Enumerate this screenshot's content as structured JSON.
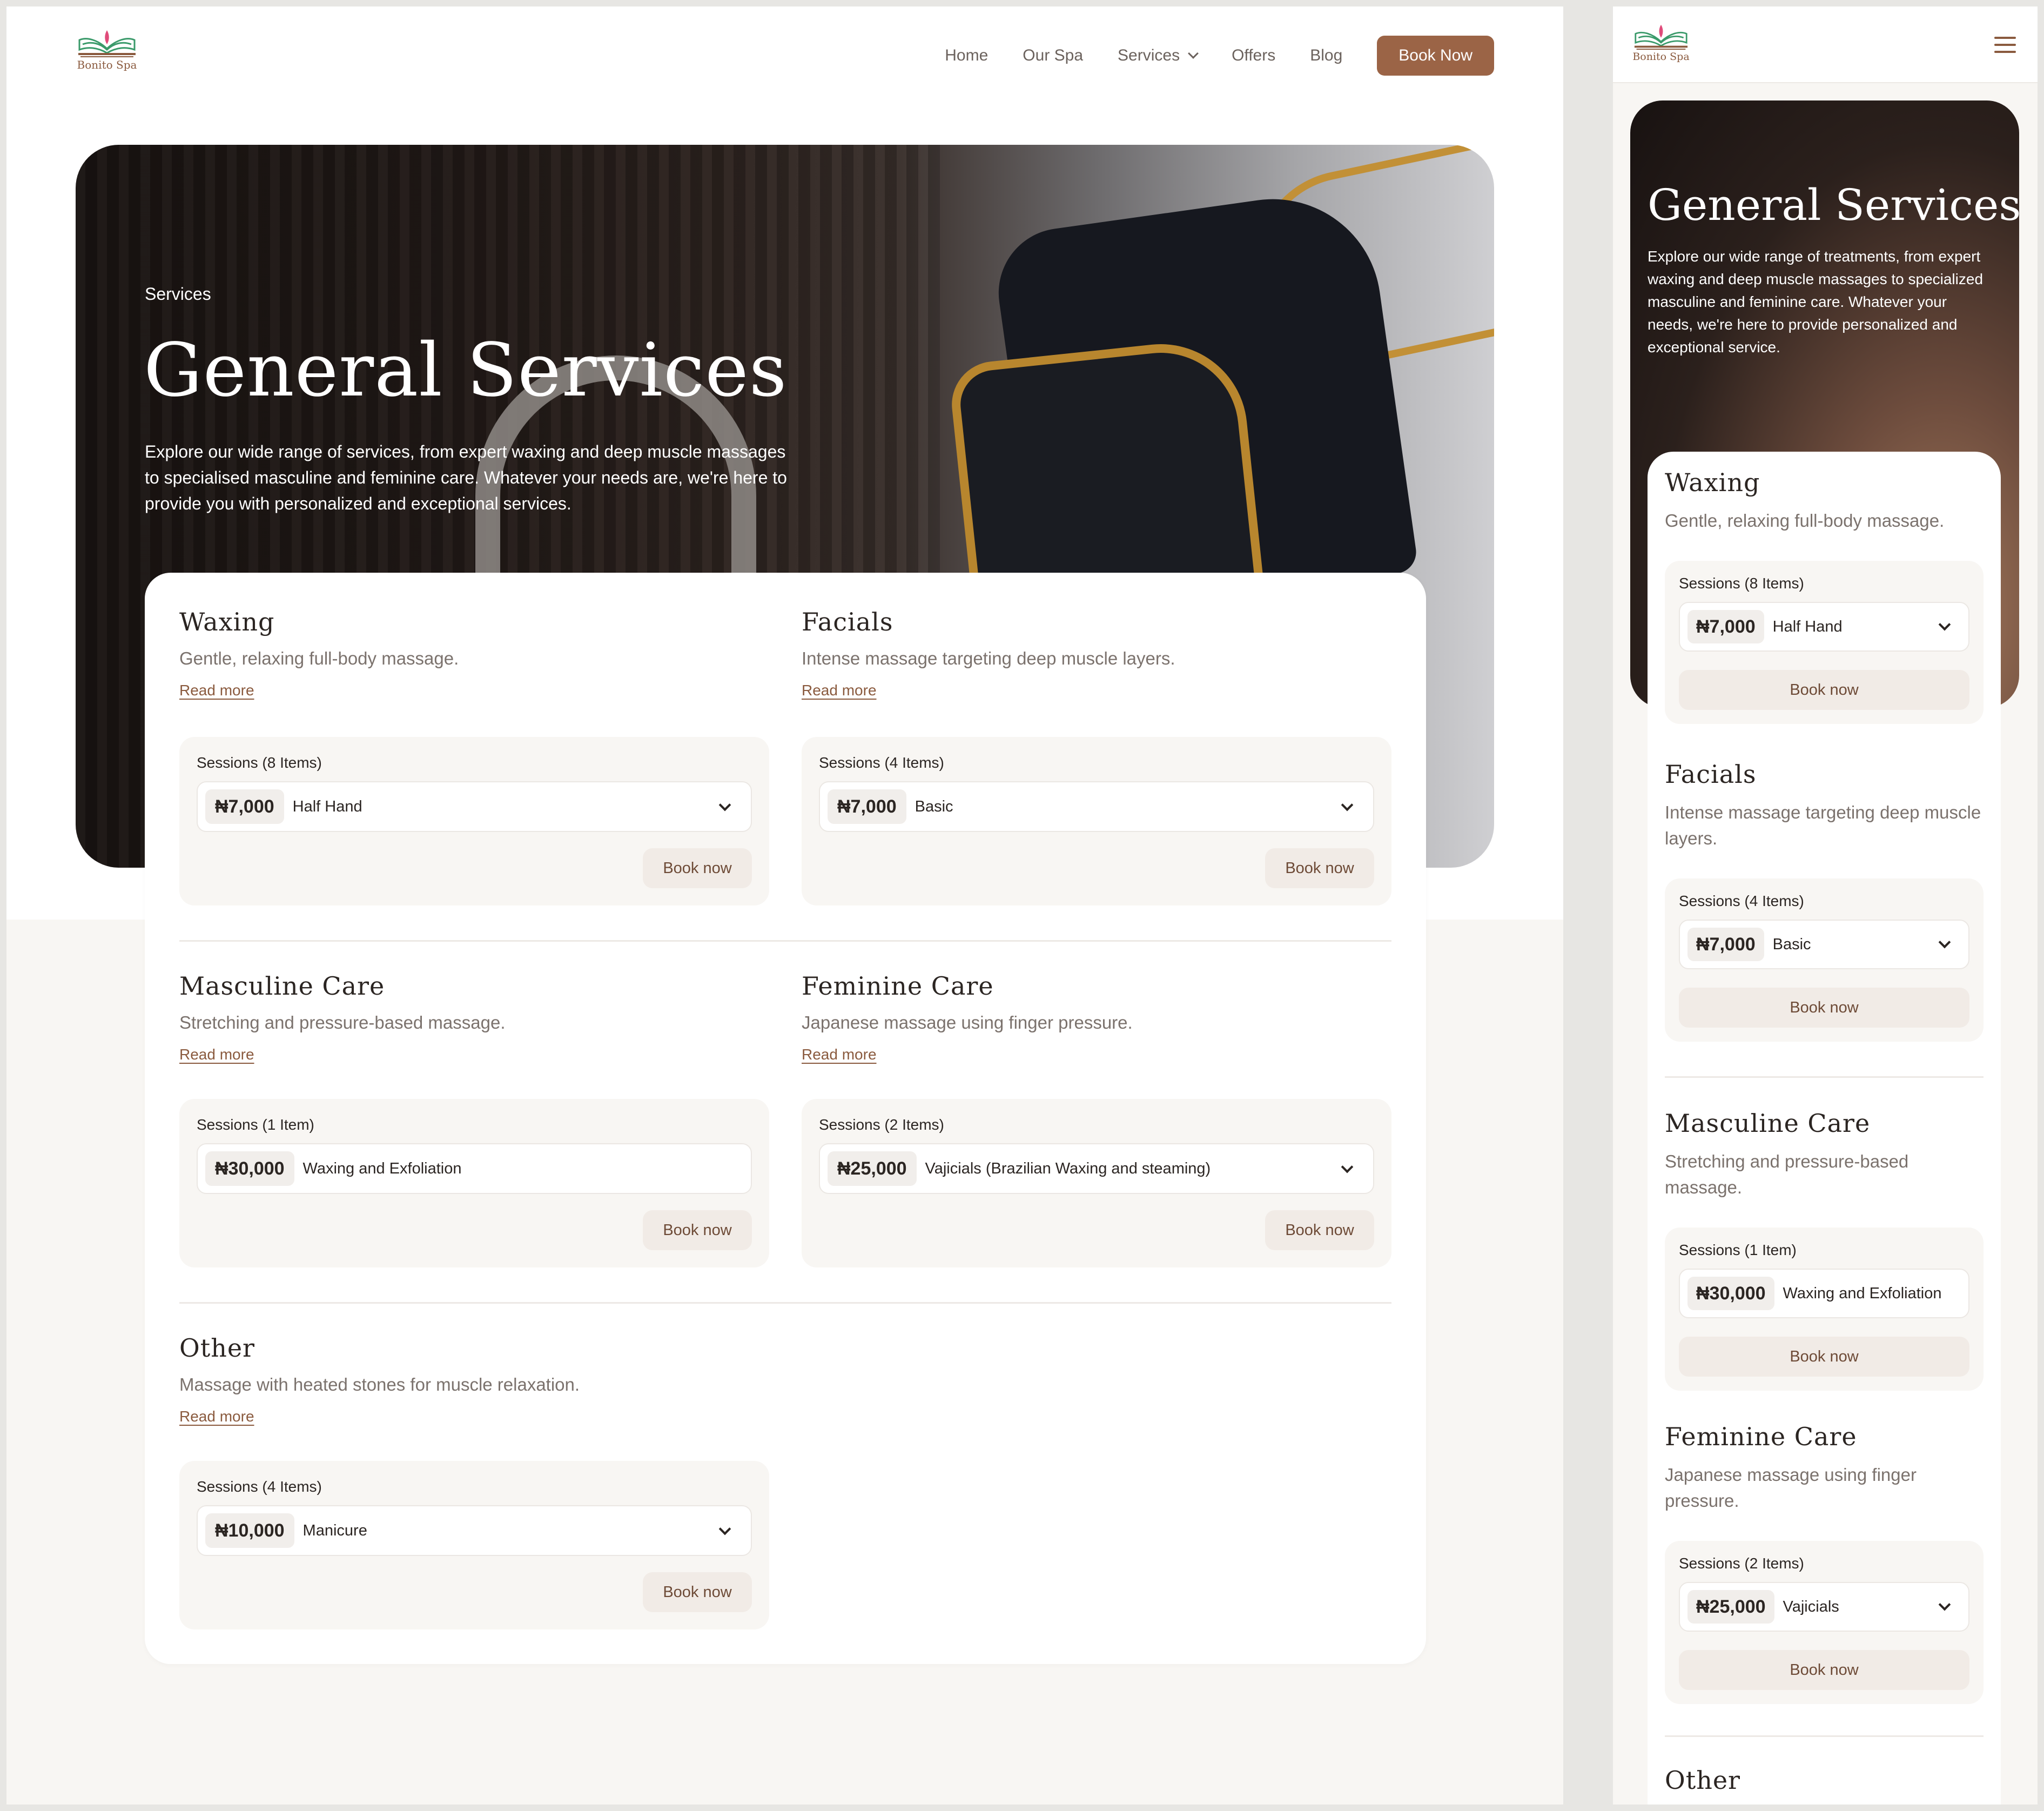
{
  "brand": {
    "name": "Bonito Spa",
    "accent": "#9b6446",
    "dark": "#2b2522",
    "logo_leaf_color": "#3a9a6a",
    "logo_flower_color": "#e04b7a"
  },
  "nav": {
    "items": [
      "Home",
      "Our Spa",
      "Services",
      "Offers",
      "Blog"
    ],
    "cta": "Book Now"
  },
  "hero": {
    "eyebrow": "Services",
    "title": "General Services",
    "desktop_text": "Explore our wide range of services, from expert waxing and deep muscle massages to specialised masculine and feminine care. Whatever your needs are, we're here to provide you with personalized and exceptional services.",
    "mobile_text": "Explore our wide range of treatments, from expert waxing and deep muscle massages to specialized masculine and feminine care. Whatever your needs, we're here to provide personalized and exceptional service."
  },
  "labels": {
    "read_more": "Read more",
    "book_now": "Book now"
  },
  "services": [
    {
      "title": "Waxing",
      "desc": "Gentle, relaxing full-body massage.",
      "sessions": "Sessions (8 Items)",
      "price": "₦7,000",
      "option": "Half Hand",
      "dropdown": true,
      "mobile_desc": "Gentle, relaxing full-body massage.",
      "mobile_option": "Half Hand"
    },
    {
      "title": "Facials",
      "desc": "Intense massage targeting deep muscle layers.",
      "sessions": "Sessions (4 Items)",
      "price": "₦7,000",
      "option": "Basic",
      "dropdown": true,
      "mobile_desc": "Intense massage targeting deep muscle layers.",
      "mobile_option": "Basic"
    },
    {
      "title": "Masculine Care",
      "desc": "Stretching and pressure-based massage.",
      "sessions": "Sessions (1 Item)",
      "price": "₦30,000",
      "option": "Waxing and Exfoliation",
      "dropdown": false,
      "mobile_desc": "Stretching and pressure-based massage.",
      "mobile_option": "Waxing and Exfoliation"
    },
    {
      "title": "Feminine Care",
      "desc": "Japanese massage using finger pressure.",
      "sessions": "Sessions (2 Items)",
      "price": "₦25,000",
      "option": "Vajicials (Brazilian Waxing and steaming)",
      "dropdown": true,
      "mobile_desc": "Japanese massage using finger pressure.",
      "mobile_option": "Vajicials"
    },
    {
      "title": "Other",
      "desc": "Massage with heated stones for muscle relaxation.",
      "sessions": "Sessions (4 Items)",
      "price": "₦10,000",
      "option": "Manicure",
      "dropdown": true
    }
  ]
}
